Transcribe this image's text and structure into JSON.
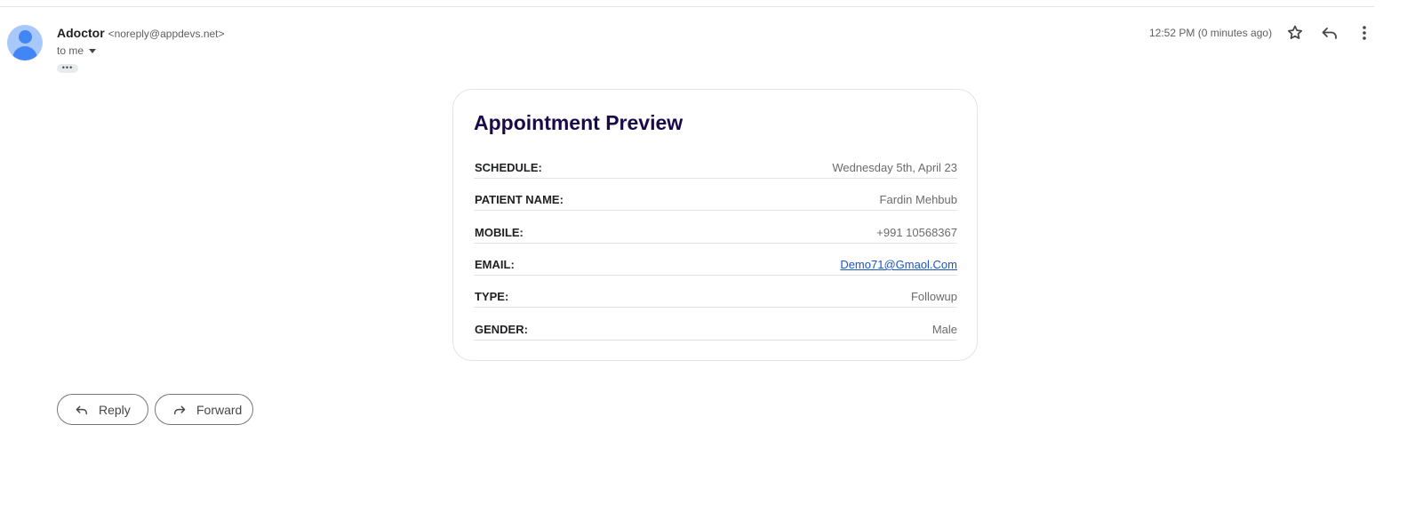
{
  "email": {
    "sender_name": "Adoctor",
    "sender_address": "<noreply@appdevs.net>",
    "recipient_label": "to me",
    "ellipsis_label": "•••",
    "timestamp": "12:52 PM (0 minutes ago)"
  },
  "icons": {
    "star": "star-icon",
    "reply": "reply-icon",
    "more": "more-vertical-icon",
    "forward": "forward-icon"
  },
  "card": {
    "title": "Appointment Preview",
    "rows": [
      {
        "label": "SCHEDULE:",
        "value": "Wednesday 5th, April 23"
      },
      {
        "label": "PATIENT NAME:",
        "value": "Fardin Mehbub"
      },
      {
        "label": "MOBILE:",
        "value": "+991 10568367"
      },
      {
        "label": "EMAIL:",
        "value": "Demo71@Gmaol.Com"
      },
      {
        "label": "TYPE:",
        "value": "Followup"
      },
      {
        "label": "GENDER:",
        "value": "Male"
      }
    ]
  },
  "actions": {
    "reply_label": "Reply",
    "forward_label": "Forward"
  },
  "colors": {
    "title": "#1a0a4a",
    "link": "#1a56c4",
    "avatar_bg": "#a8c7fa",
    "avatar_fg": "#4285f4"
  }
}
